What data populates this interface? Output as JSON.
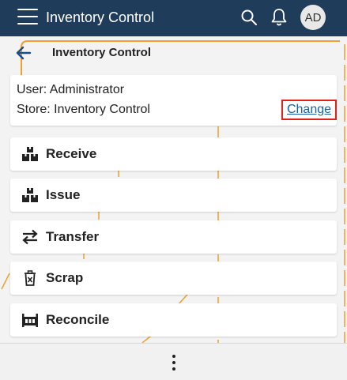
{
  "appbar": {
    "title": "Inventory Control",
    "avatar_initials": "AD",
    "icons": [
      "menu-icon",
      "search-icon",
      "bell-icon"
    ]
  },
  "page": {
    "title": "Inventory Control"
  },
  "info": {
    "user": "User: Administrator",
    "store": "Store: Inventory Control",
    "change_label": "Change"
  },
  "menu": {
    "items": [
      {
        "label": "Receive",
        "icon": "boxes-icon"
      },
      {
        "label": "Issue",
        "icon": "boxes-icon"
      },
      {
        "label": "Transfer",
        "icon": "transfer-arrows-icon"
      },
      {
        "label": "Scrap",
        "icon": "trash-icon"
      },
      {
        "label": "Reconcile",
        "icon": "reconcile-icon"
      }
    ]
  },
  "colors": {
    "appbar_bg": "#1f3d5a",
    "accent_line": "#f0a030",
    "link": "#1a5fa8",
    "highlight_border": "#e0201b"
  }
}
